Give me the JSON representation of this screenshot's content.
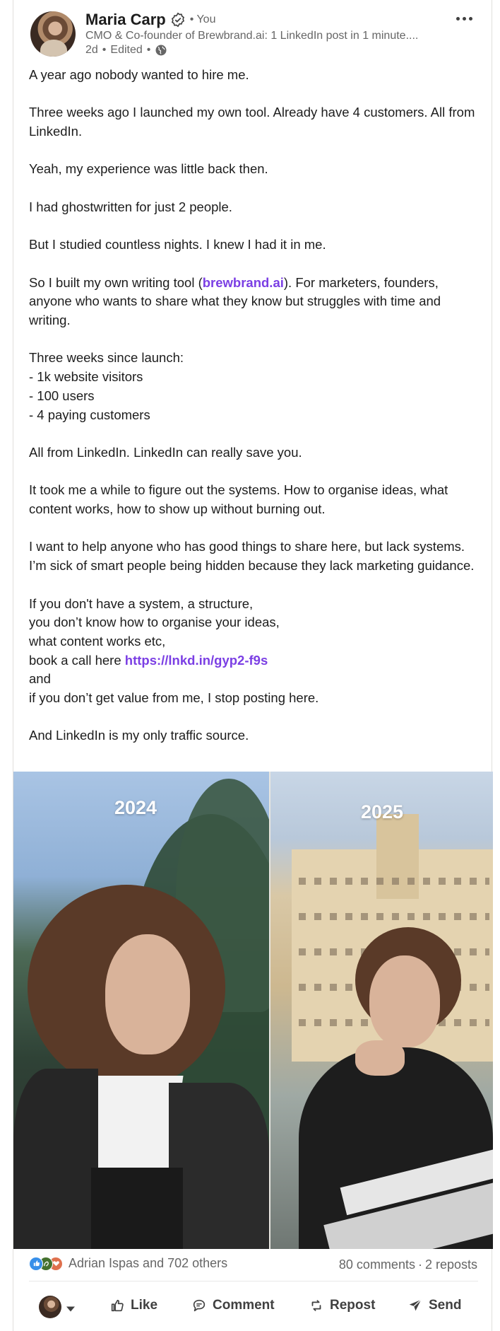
{
  "post": {
    "author": {
      "name": "Maria Carp",
      "you_tag": "• You",
      "headline": "CMO & Co-founder of Brewbrand.ai: 1 LinkedIn post in 1 minute....",
      "time": "2d",
      "edited": "Edited",
      "dot": "•"
    },
    "body": {
      "p1": "A year ago nobody wanted to hire me.",
      "p2": "Three weeks ago I launched my own tool. Already have 4 customers. All from LinkedIn.",
      "p3": "Yeah, my experience was little back then.",
      "p4": "I had ghostwritten for just 2 people.",
      "p5": "But I studied countless nights. I knew I had it in me.",
      "p6_before": "So I built my own writing tool (",
      "p6_link": "brewbrand.ai",
      "p6_after": "). For marketers, founders, anyone who wants to share what they know but struggles with time and writing.",
      "p7_l1": "Three weeks since launch:",
      "p7_l2": "- 1k website visitors",
      "p7_l3": "- 100 users",
      "p7_l4": "- 4 paying customers",
      "p8": "All from LinkedIn. LinkedIn can really save you.",
      "p9": "It took me a while to figure out the systems. How to organise ideas, what content works, how to show up without burning out.",
      "p10": "I want to help anyone who has good things to share here, but lack systems. I’m sick of smart people being hidden because they lack marketing guidance.",
      "p11_l1": "If you don't have a system, a structure,",
      "p11_l2": "you don’t know how to organise your ideas,",
      "p11_l3": "what content works etc,",
      "p11_l4_before": "book a call here ",
      "p11_l4_link": "https://lnkd.in/gyp2-f9s",
      "p11_l5": "and",
      "p11_l6": "if you don’t get value from me, I stop posting here.",
      "p12": "And LinkedIn is my only traffic source."
    },
    "media": {
      "left_label": "2024",
      "right_label": "2025"
    },
    "social": {
      "reactions_text": "Adrian Ispas and 702 others",
      "comments": "80 comments",
      "separator": "·",
      "reposts": "2 reposts"
    },
    "actions": {
      "like": "Like",
      "comment": "Comment",
      "repost": "Repost",
      "send": "Send"
    },
    "colors": {
      "link": "#7b3fe4",
      "like_reaction": "#378fe9",
      "celebrate_reaction": "#44712e",
      "love_reaction": "#df704d"
    }
  }
}
